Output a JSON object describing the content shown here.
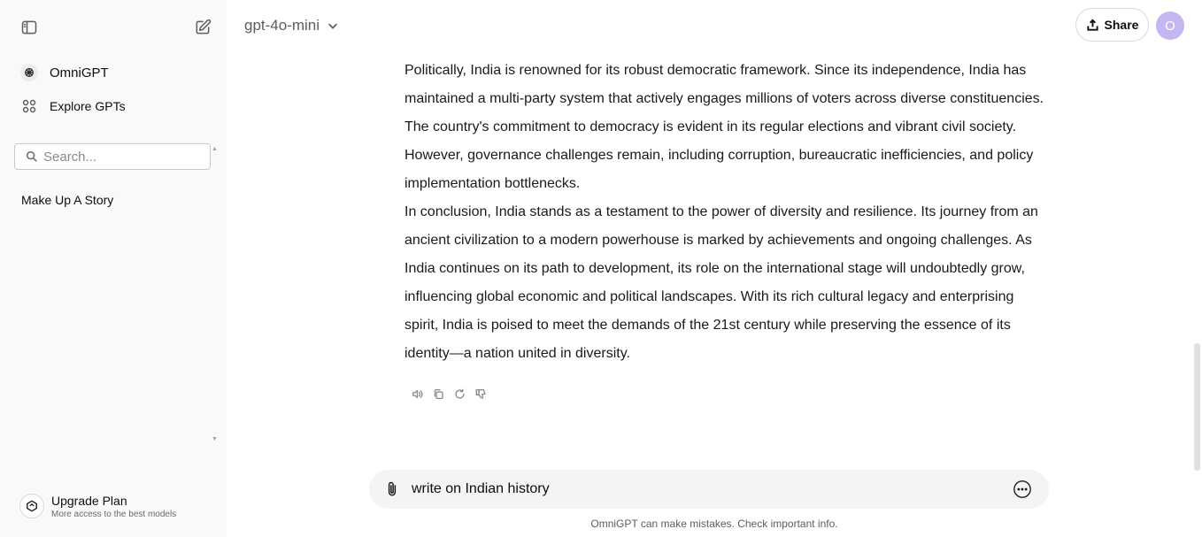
{
  "sidebar": {
    "brand_label": "OmniGPT",
    "explore_label": "Explore GPTs",
    "search_placeholder": "Search...",
    "history": [
      {
        "label": "Make Up A Story"
      }
    ],
    "upgrade": {
      "title": "Upgrade Plan",
      "subtitle": "More access to the best models"
    }
  },
  "header": {
    "model_label": "gpt-4o-mini",
    "share_label": "Share",
    "avatar_initial": "O",
    "avatar_color": "#c3b6f2"
  },
  "message": {
    "paragraphs": [
      "Politically, India is renowned for its robust democratic framework. Since its independence, India has maintained a multi-party system that actively engages millions of voters across diverse constituencies. The country's commitment to democracy is evident in its regular elections and vibrant civil society. However, governance challenges remain, including corruption, bureaucratic inefficiencies, and policy implementation bottlenecks.",
      "In conclusion, India stands as a testament to the power of diversity and resilience. Its journey from an ancient civilization to a modern powerhouse is marked by achievements and ongoing challenges. As India continues on its path to development, its role on the international stage will undoubtedly grow, influencing global economic and political landscapes. With its rich cultural legacy and enterprising spirit, India is poised to meet the demands of the 21st century while preserving the essence of its identity—a nation united in diversity."
    ],
    "actions": [
      "read-aloud-icon",
      "copy-icon",
      "regenerate-icon",
      "thumbs-down-icon"
    ]
  },
  "composer": {
    "value": "write on Indian history"
  },
  "disclaimer": "OmniGPT can make mistakes. Check important info."
}
